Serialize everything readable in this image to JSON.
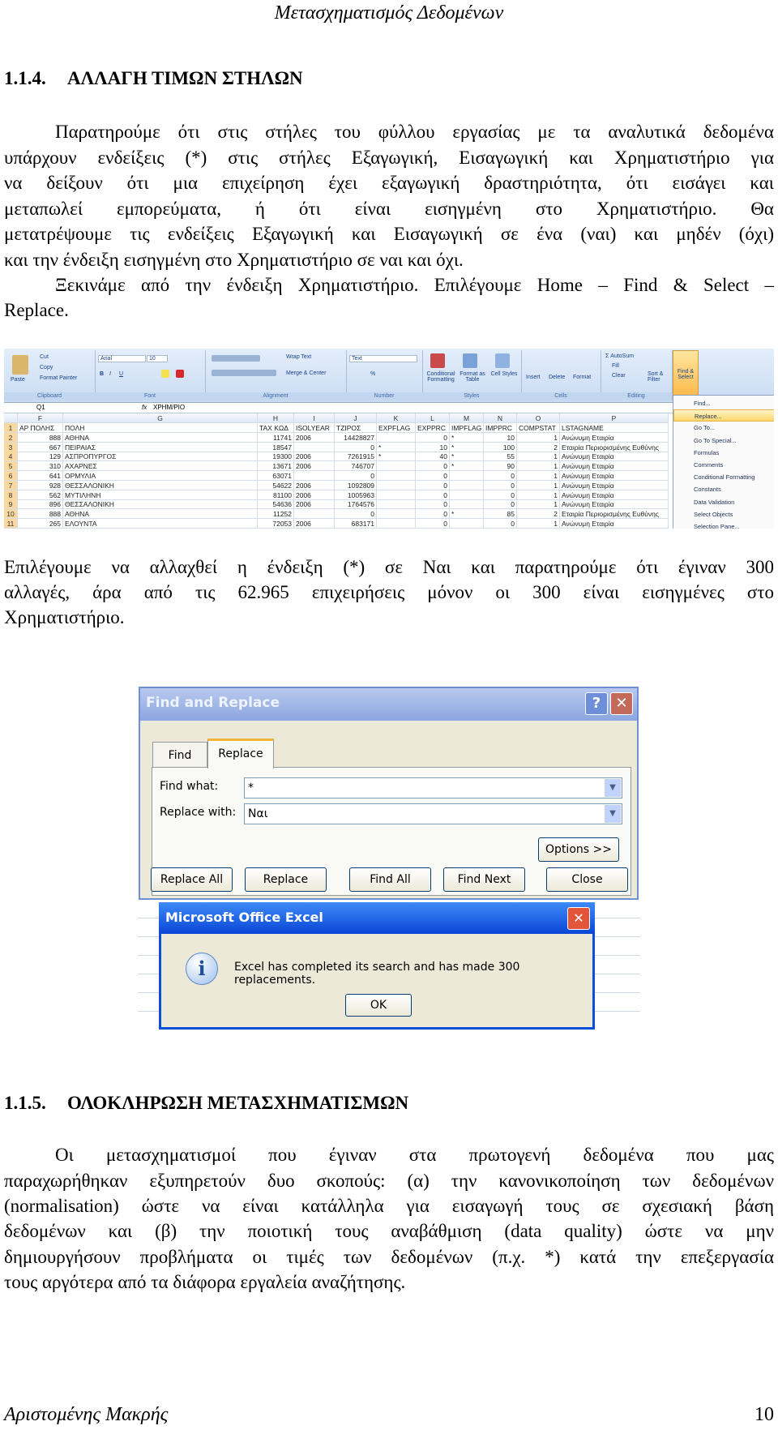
{
  "header": {
    "title": "Μετασχηματισμός Δεδομένων"
  },
  "section1": {
    "number": "1.1.4.",
    "title": "ΑΛΛΑΓΗ ΤΙΜΩΝ ΣΤΗΛΩΝ",
    "para1": [
      "Παρατηρούμε ότι στις στήλες του φύλλου εργασίας με τα αναλυτικά δεδομένα",
      "υπάρχουν ενδείξεις (*) στις στήλες Εξαγωγική, Εισαγωγική και Χρηματιστήριο για",
      "να δείξουν ότι μια επιχείρηση έχει εξαγωγική δραστηριότητα, ότι εισάγει και",
      "μεταπωλεί εμπορεύματα, ή ότι είναι εισηγμένη στο Χρηματιστήριο. Θα",
      "μετατρέψουμε τις ενδείξεις Εξαγωγική και Εισαγωγική σε ένα (ναι) και μηδέν (όχι)",
      "και την ένδειξη εισηγμένη στο Χρηματιστήριο σε ναι και όχι."
    ],
    "para2": [
      "Ξεκινάμε από την ένδειξη Χρηματιστήριο. Επιλέγουμε Home – Find & Select –",
      "Replace."
    ],
    "para3": [
      "Επιλέγουμε να αλλαχθεί η ένδειξη (*) σε Ναι και παρατηρούμε ότι έγιναν 300",
      "αλλαγές, άρα από τις 62.965 επιχειρήσεις μόνον οι 300 είναι εισηγμένες στο",
      "Χρηματιστήριο."
    ]
  },
  "excel": {
    "ribbon": {
      "groups": [
        "Clipboard",
        "Font",
        "Alignment",
        "Number",
        "Styles",
        "Cells",
        "Editing"
      ],
      "paste": "Paste",
      "cut": "Cut",
      "copy": "Copy",
      "format_painter": "Format Painter",
      "font_name": "Arial",
      "font_size": "10",
      "wrap_text": "Wrap Text",
      "merge_center": "Merge & Center",
      "number_format": "Text",
      "percent": "%",
      "conditional_formatting": "Conditional Formatting",
      "format_as_table": "Format as Table",
      "cell_styles": "Cell Styles",
      "insert": "Insert",
      "delete": "Delete",
      "format": "Format",
      "autosum": "AutoSum",
      "fill": "Fill",
      "clear": "Clear",
      "sort_filter": "Sort & Filter",
      "find_select": "Find & Select"
    },
    "name_box": "Q1",
    "formula": "XPHM/PIO",
    "columns": [
      "F",
      "G",
      "H",
      "I",
      "J",
      "K",
      "L",
      "M",
      "N",
      "O",
      "P"
    ],
    "rows": [
      [
        "1",
        "ΑΡ ΠΟΛΗΣ",
        "ΠΟΛΗ",
        "TAX ΚΩΔ",
        "ISOLYEAR",
        "ΤΖΙΡΟΣ",
        "EXPFLAG",
        "EXPPRC",
        "IMPFLAG",
        "IMPPRC",
        "COMPSTAT",
        "LSTAGNAME"
      ],
      [
        "2",
        "888",
        "ΑΘΗΝΑ",
        "11741",
        "2006",
        "14428827",
        "",
        "0",
        "*",
        "10",
        "1",
        "Ανώνυμη Εταιρία"
      ],
      [
        "3",
        "667",
        "ΠΕΙΡΑΙΑΣ",
        "18547",
        "",
        "0",
        "*",
        "10",
        "*",
        "100",
        "2",
        "Εταιρία Περιορισμένης Ευθύνης"
      ],
      [
        "4",
        "129",
        "ΑΣΠΡΟΠΥΡΓΟΣ",
        "19300",
        "2006",
        "7261915",
        "*",
        "40",
        "*",
        "55",
        "1",
        "Ανώνυμη Εταιρία"
      ],
      [
        "5",
        "310",
        "ΑΧΑΡΝΕΣ",
        "13671",
        "2006",
        "746707",
        "",
        "0",
        "*",
        "90",
        "1",
        "Ανώνυμη Εταιρία"
      ],
      [
        "6",
        "641",
        "ΟΡΜΥΛΙΑ",
        "63071",
        "",
        "0",
        "",
        "0",
        "",
        "0",
        "1",
        "Ανώνυμη Εταιρία"
      ],
      [
        "7",
        "928",
        "ΘΕΣΣΑΛΟΝΙΚΗ",
        "54622",
        "2006",
        "1092809",
        "",
        "0",
        "",
        "0",
        "1",
        "Ανώνυμη Εταιρία"
      ],
      [
        "8",
        "562",
        "ΜΥΤΙΛΗΝΗ",
        "81100",
        "2006",
        "1005963",
        "",
        "0",
        "",
        "0",
        "1",
        "Ανώνυμη Εταιρία"
      ],
      [
        "9",
        "896",
        "ΘΕΣΣΑΛΟΝΙΚΗ",
        "54636",
        "2006",
        "1764576",
        "",
        "0",
        "",
        "0",
        "1",
        "Ανώνυμη Εταιρία"
      ],
      [
        "10",
        "888",
        "ΑΘΗΝΑ",
        "11252",
        "",
        "0",
        "",
        "0",
        "*",
        "85",
        "2",
        "Εταιρία Περιορισμένης Ευθύνης"
      ],
      [
        "11",
        "265",
        "ΕΛΟΥΝΤΑ",
        "72053",
        "2006",
        "683171",
        "",
        "0",
        "",
        "0",
        "1",
        "Ανώνυμη Εταιρία"
      ]
    ],
    "menu": [
      "Find...",
      "Replace...",
      "Go To...",
      "Go To Special...",
      "Formulas",
      "Comments",
      "Conditional Formatting",
      "Constants",
      "Data Validation",
      "Select Objects",
      "Selection Pane..."
    ],
    "menu_selected": "Replace..."
  },
  "find_replace": {
    "title": "Find and Replace",
    "help": "?",
    "close": "✕",
    "tabs": [
      "Find",
      "Replace"
    ],
    "active_tab": "Replace",
    "find_label": "Find what:",
    "find_value": "*",
    "replace_label": "Replace with:",
    "replace_value": "Ναι",
    "options": "Options >>",
    "buttons": [
      "Replace All",
      "Replace",
      "Find All",
      "Find Next",
      "Close"
    ]
  },
  "message_box": {
    "title": "Microsoft Office Excel",
    "close": "✕",
    "icon": "info-icon",
    "icon_glyph": "i",
    "text": "Excel has completed its search and has made 300 replacements.",
    "ok": "OK"
  },
  "section2": {
    "number": "1.1.5.",
    "title": "ΟΛΟΚΛΗΡΩΣΗ ΜΕΤΑΣΧΗΜΑΤΙΣΜΩΝ",
    "para": [
      "Οι μετασχηματισμοί που έγιναν στα πρωτογενή δεδομένα που μας",
      "παραχωρήθηκαν εξυπηρετούν δυο σκοπούς: (α) την κανονικοποίηση των δεδομένων",
      "(normalisation) ώστε να είναι κατάλληλα για εισαγωγή τους σε σχεσιακή βάση",
      "δεδομένων και (β) την ποιοτική τους αναβάθμιση (data quality) ώστε να μην",
      "δημιουργήσουν προβλήματα οι τιμές των δεδομένων (π.χ. *) κατά την επεξεργασία",
      "τους αργότερα από τα διάφορα εργαλεία αναζήτησης."
    ]
  },
  "footer": {
    "author": "Αριστομένης Μακρής",
    "page": "10"
  }
}
